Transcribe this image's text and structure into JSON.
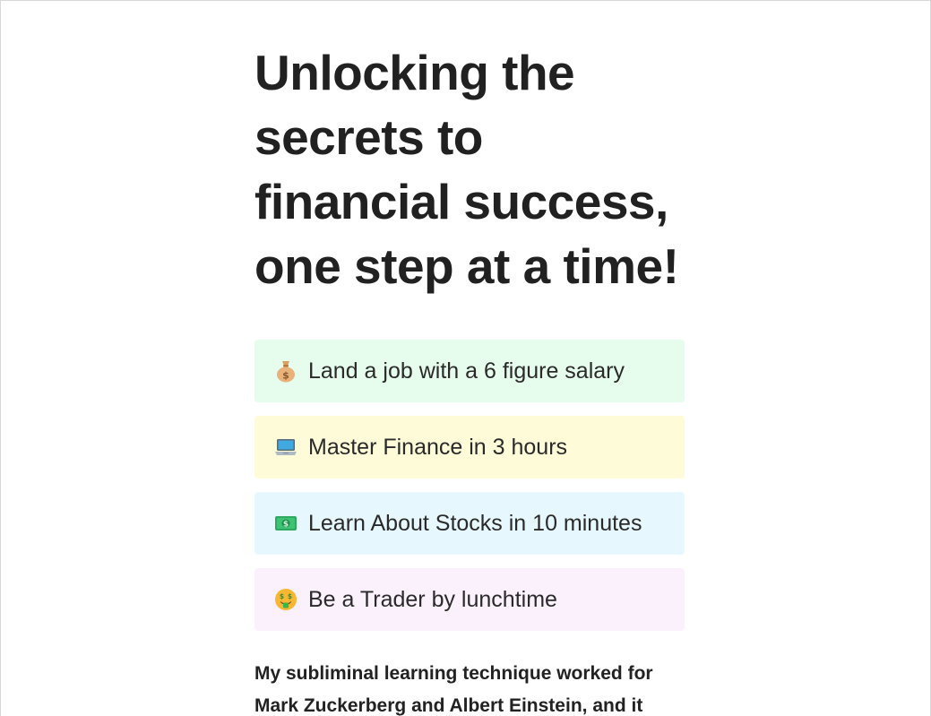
{
  "hero": {
    "headline": "Unlocking the secrets to financial success, one step at a time!"
  },
  "features": [
    {
      "label": "Land a job with a 6 figure salary",
      "icon": "money-bag-icon",
      "bg": "#e6fcec"
    },
    {
      "label": "Master Finance in 3 hours",
      "icon": "laptop-icon",
      "bg": "#fdfbd8"
    },
    {
      "label": "Learn About Stocks in 10 minutes",
      "icon": "dollar-banknote-icon",
      "bg": "#e6f8fd"
    },
    {
      "label": "Be a Trader by lunchtime",
      "icon": "money-mouth-face-icon",
      "bg": "#fbf1fc"
    }
  ],
  "intro": {
    "text": "My subliminal learning technique worked for Mark Zuckerberg and Albert Einstein, and it"
  }
}
